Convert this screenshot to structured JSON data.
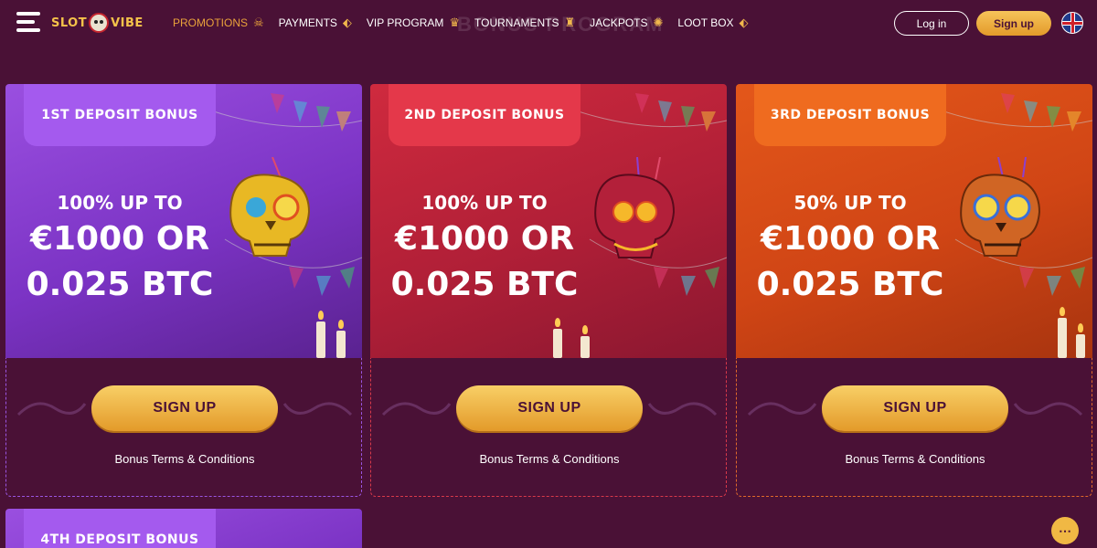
{
  "header": {
    "logo_text_left": "SLOT",
    "logo_text_right": "VIBE",
    "ghost_title": "BONUS PROGRAM",
    "login_label": "Log in",
    "signup_label": "Sign up",
    "language_icon": "uk-flag-icon",
    "nav": [
      {
        "label": "PROMOTIONS",
        "icon": "skull-icon",
        "active": true
      },
      {
        "label": "PAYMENTS",
        "icon": "tag-icon"
      },
      {
        "label": "VIP PROGRAM",
        "icon": "crown-icon"
      },
      {
        "label": "TOURNAMENTS",
        "icon": "trophy-icon"
      },
      {
        "label": "JACKPOTS",
        "icon": "sparkle-icon"
      },
      {
        "label": "LOOT BOX",
        "icon": "tag-icon"
      }
    ]
  },
  "cards": [
    {
      "badge": "1ST DEPOSIT BONUS",
      "line1": "100% UP TO",
      "line2": "€1000 OR",
      "line3": "0.025 BTC",
      "cta": "SIGN UP",
      "terms": "Bonus Terms & Conditions",
      "color": "#8a3fd6",
      "badge_color": "#a24ee8",
      "border": "#9a55e0",
      "skull_color": "#e8b824"
    },
    {
      "badge": "2ND DEPOSIT BONUS",
      "line1": "100% UP TO",
      "line2": "€1000 OR",
      "line3": "0.025 BTC",
      "cta": "SIGN UP",
      "terms": "Bonus Terms & Conditions",
      "color": "#b8203a",
      "badge_color": "#e53546",
      "border": "#d8394a",
      "skull_color": "#c2263e"
    },
    {
      "badge": "3RD DEPOSIT BONUS",
      "line1": "50% UP TO",
      "line2": "€1000 OR",
      "line3": "0.025 BTC",
      "cta": "SIGN UP",
      "terms": "Bonus Terms & Conditions",
      "color": "#d44a12",
      "badge_color": "#ee6a1e",
      "border": "#e0692a",
      "skull_color": "#d06524"
    },
    {
      "badge": "4TH DEPOSIT BONUS",
      "color": "#8a3fd6",
      "badge_color": "#a24ee8"
    }
  ],
  "chat_icon": "chat-icon"
}
